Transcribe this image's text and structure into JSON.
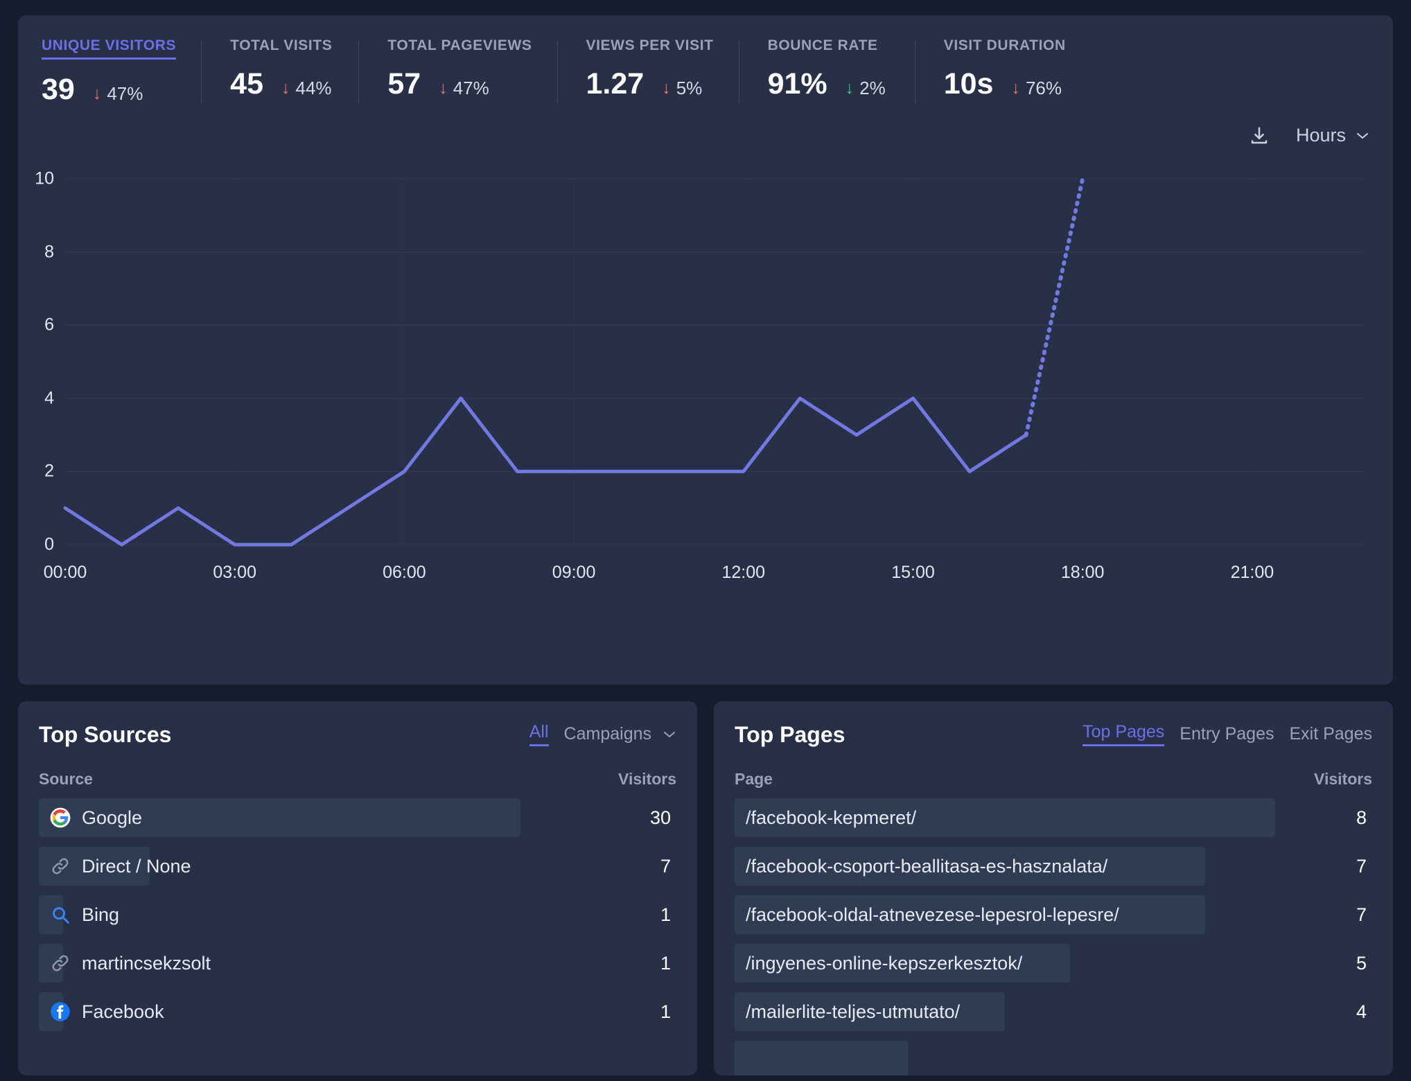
{
  "metrics": [
    {
      "label": "UNIQUE VISITORS",
      "value": "39",
      "change": "47%",
      "direction": "down",
      "tone": "red",
      "active": true
    },
    {
      "label": "TOTAL VISITS",
      "value": "45",
      "change": "44%",
      "direction": "down",
      "tone": "red",
      "active": false
    },
    {
      "label": "TOTAL PAGEVIEWS",
      "value": "57",
      "change": "47%",
      "direction": "down",
      "tone": "red",
      "active": false
    },
    {
      "label": "VIEWS PER VISIT",
      "value": "1.27",
      "change": "5%",
      "direction": "down",
      "tone": "red",
      "active": false
    },
    {
      "label": "BOUNCE RATE",
      "value": "91%",
      "change": "2%",
      "direction": "down",
      "tone": "green",
      "active": false
    },
    {
      "label": "VISIT DURATION",
      "value": "10s",
      "change": "76%",
      "direction": "down",
      "tone": "red",
      "active": false
    }
  ],
  "toolbar": {
    "download_icon": "download-icon",
    "interval_label": "Hours",
    "chevron_icon": "chevron-down-icon"
  },
  "chart_data": {
    "type": "line",
    "title": "",
    "xlabel": "",
    "ylabel": "",
    "ylim": [
      0,
      10
    ],
    "yticks": [
      0,
      2,
      4,
      6,
      8,
      10
    ],
    "grid": true,
    "legend": false,
    "line_color": "#7179e0",
    "x": [
      "00:00",
      "01:00",
      "02:00",
      "03:00",
      "04:00",
      "05:00",
      "06:00",
      "07:00",
      "08:00",
      "09:00",
      "10:00",
      "11:00",
      "12:00",
      "13:00",
      "14:00",
      "15:00",
      "16:00",
      "17:00",
      "18:00"
    ],
    "xtick_labels": [
      "00:00",
      "03:00",
      "06:00",
      "09:00",
      "12:00",
      "15:00",
      "18:00",
      "21:00"
    ],
    "xtick_hours": [
      0,
      3,
      6,
      9,
      12,
      15,
      18,
      21
    ],
    "series": [
      {
        "name": "Unique visitors",
        "values": [
          1,
          0,
          1,
          0,
          0,
          1,
          2,
          4,
          2,
          2,
          2,
          2,
          2,
          4,
          3,
          4,
          2,
          3,
          10
        ]
      }
    ],
    "dashed_from_index": 17,
    "x_domain_hours": [
      0,
      23
    ]
  },
  "top_sources": {
    "title": "Top Sources",
    "tabs": [
      {
        "label": "All",
        "active": true
      },
      {
        "label": "Campaigns",
        "active": false
      }
    ],
    "chevron_icon": "chevron-down-icon",
    "col_source": "Source",
    "col_visitors": "Visitors",
    "rows": [
      {
        "name": "Google",
        "visitors": "30",
        "icon": "google-icon",
        "pct": 100
      },
      {
        "name": "Direct / None",
        "visitors": "7",
        "icon": "link-icon",
        "pct": 23
      },
      {
        "name": "Bing",
        "visitors": "1",
        "icon": "search-icon",
        "pct": 5
      },
      {
        "name": "martincsekzsolt",
        "visitors": "1",
        "icon": "link-icon",
        "pct": 5
      },
      {
        "name": "Facebook",
        "visitors": "1",
        "icon": "facebook-icon",
        "pct": 5
      }
    ]
  },
  "top_pages": {
    "title": "Top Pages",
    "tabs": [
      {
        "label": "Top Pages",
        "active": true
      },
      {
        "label": "Entry Pages",
        "active": false
      },
      {
        "label": "Exit Pages",
        "active": false
      }
    ],
    "col_page": "Page",
    "col_visitors": "Visitors",
    "rows": [
      {
        "name": "/facebook-kepmeret/",
        "visitors": "8",
        "pct": 100
      },
      {
        "name": "/facebook-csoport-beallitasa-es-hasznalata/",
        "visitors": "7",
        "pct": 87
      },
      {
        "name": "/facebook-oldal-atnevezese-lepesrol-lepesre/",
        "visitors": "7",
        "pct": 87
      },
      {
        "name": "/ingyenes-online-kepszerkesztok/",
        "visitors": "5",
        "pct": 62
      },
      {
        "name": "/mailerlite-teljes-utmutato/",
        "visitors": "4",
        "pct": 50
      },
      {
        "name": "",
        "visitors": "",
        "pct": 32
      }
    ]
  },
  "colors": {
    "accent": "#6b6fe8",
    "line": "#7179e0",
    "panel_bg": "#273047",
    "page_bg": "#161d2f",
    "bar": "#303b54",
    "down_red": "#ef6f6c",
    "down_green": "#3ec97a"
  }
}
